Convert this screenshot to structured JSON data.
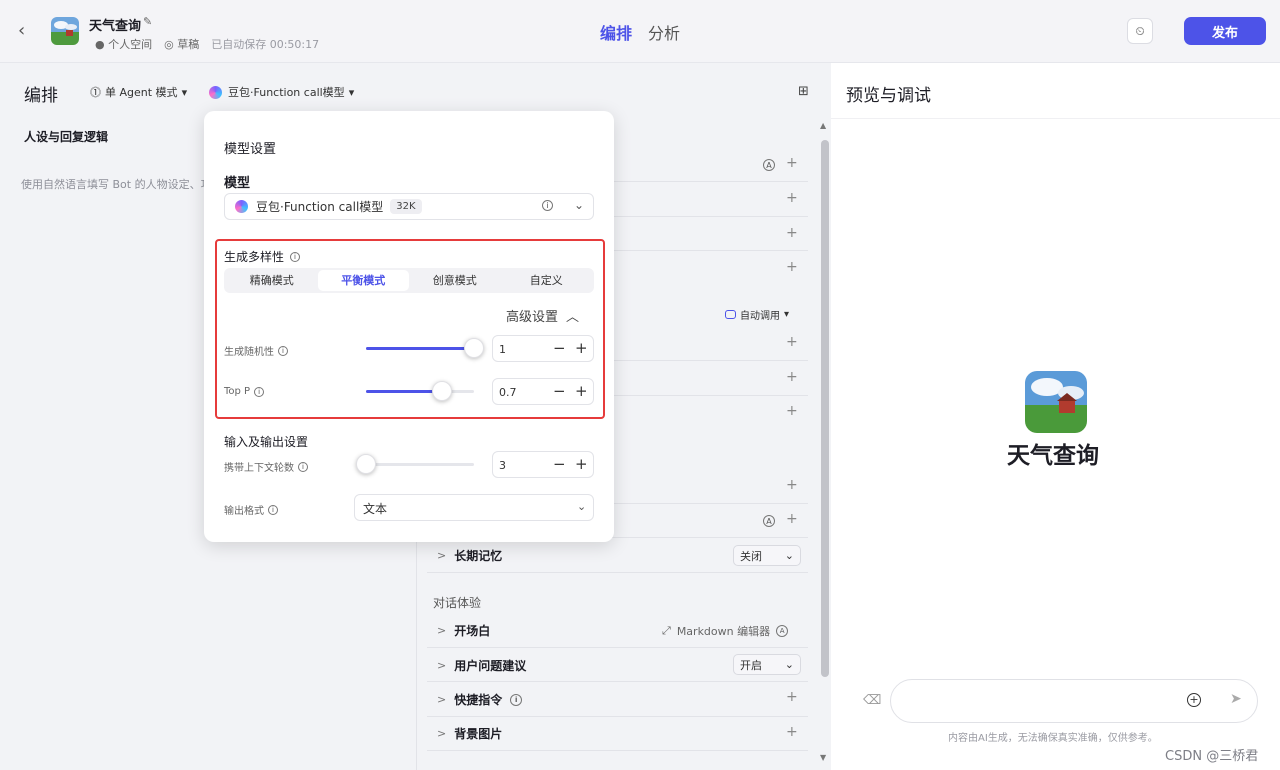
{
  "header": {
    "bot_name": "天气查询",
    "space": "个人空间",
    "status": "草稿",
    "autosave": "已自动保存 00:50:17",
    "tabs": [
      "编排",
      "分析"
    ],
    "publish": "发布"
  },
  "left": {
    "title": "编排",
    "mode": "单 Agent 模式",
    "model": "豆包·Function call模型",
    "persona_title": "人设与回复逻辑",
    "persona_hint": "使用自然语言填写 Bot 的人物设定、功能"
  },
  "list": {
    "auto_call": "自动调用",
    "long_memory": "长期记忆",
    "long_memory_value": "关闭",
    "dialog_section": "对话体验",
    "opening": "开场白",
    "markdown_editor": "Markdown 编辑器",
    "suggestions": "用户问题建议",
    "suggestions_value": "开启",
    "shortcuts": "快捷指令",
    "background": "背景图片"
  },
  "popup": {
    "title": "模型设置",
    "model_label": "模型",
    "model_name": "豆包·Function call模型",
    "model_badge": "32K",
    "gen_label": "生成多样性",
    "modes": [
      "精确模式",
      "平衡模式",
      "创意模式",
      "自定义"
    ],
    "advanced": "高级设置",
    "temperature_label": "生成随机性",
    "temperature_value": "1",
    "temperature_fraction": 1.0,
    "topp_label": "Top P",
    "topp_value": "0.7",
    "topp_fraction": 0.7,
    "io_label": "输入及输出设置",
    "context_label": "携带上下文轮数",
    "context_value": "3",
    "context_fraction": 0.0,
    "format_label": "输出格式",
    "format_value": "文本"
  },
  "preview": {
    "title": "预览与调试",
    "bot_name": "天气查询",
    "disclaimer": "内容由AI生成，无法确保真实准确，仅供参考。",
    "watermark": "CSDN @三桥君"
  },
  "colors": {
    "accent": "#4d53e8",
    "highlight_box": "#e63b3b"
  }
}
